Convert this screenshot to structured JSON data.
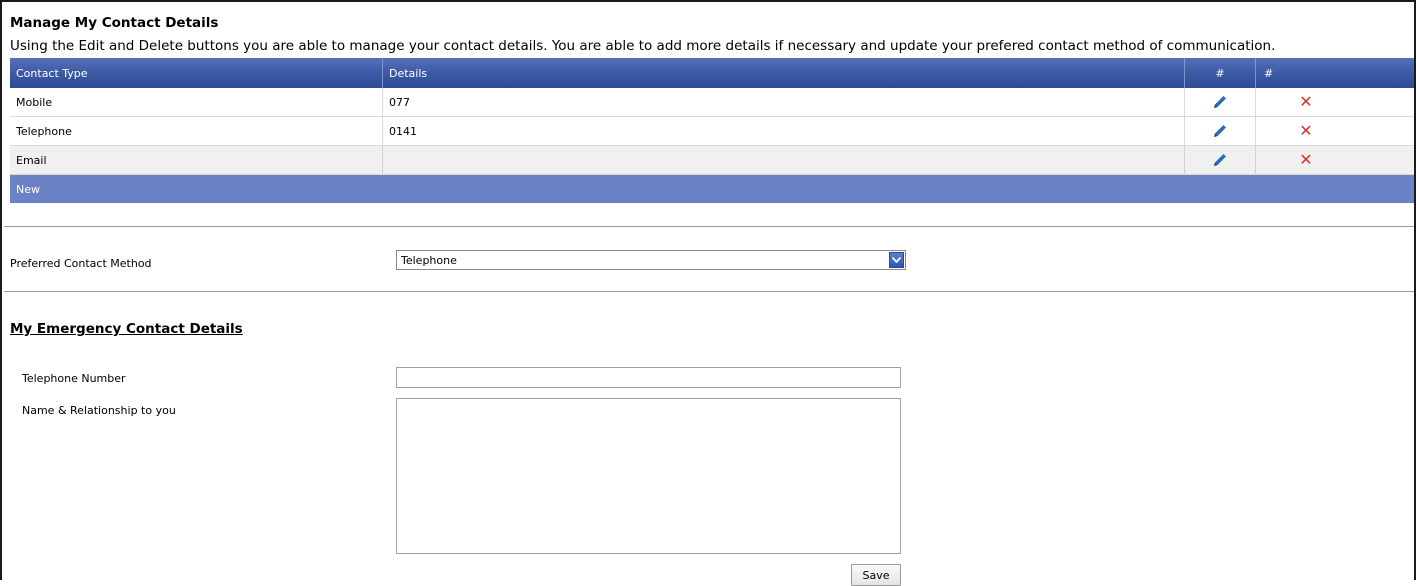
{
  "page": {
    "title": "Manage My Contact Details",
    "intro": "Using the Edit and Delete buttons you are able to manage your contact details. You are able to add more details if necessary and update your prefered contact method of communication."
  },
  "contacts_table": {
    "headers": {
      "type": "Contact Type",
      "details": "Details",
      "edit": "#",
      "delete": "#"
    },
    "rows": [
      {
        "type": "Mobile",
        "details": "077"
      },
      {
        "type": "Telephone",
        "details": "0141"
      },
      {
        "type": "Email",
        "details": ""
      }
    ],
    "new_label": "New",
    "edit_icon": "pencil-icon",
    "delete_icon": "close-icon"
  },
  "preferred": {
    "label": "Preferred Contact Method",
    "selected": "Telephone"
  },
  "emergency": {
    "title": "My Emergency Contact Details",
    "telephone_label": "Telephone Number",
    "telephone_value": "",
    "name_label": "Name & Relationship to you",
    "name_value": ""
  },
  "actions": {
    "save_label": "Save"
  },
  "colors": {
    "header_blue": "#3d5aa6",
    "new_row_blue": "#6b82c6",
    "edit_icon": "#2a6bb5",
    "delete_icon": "#d6342a"
  }
}
